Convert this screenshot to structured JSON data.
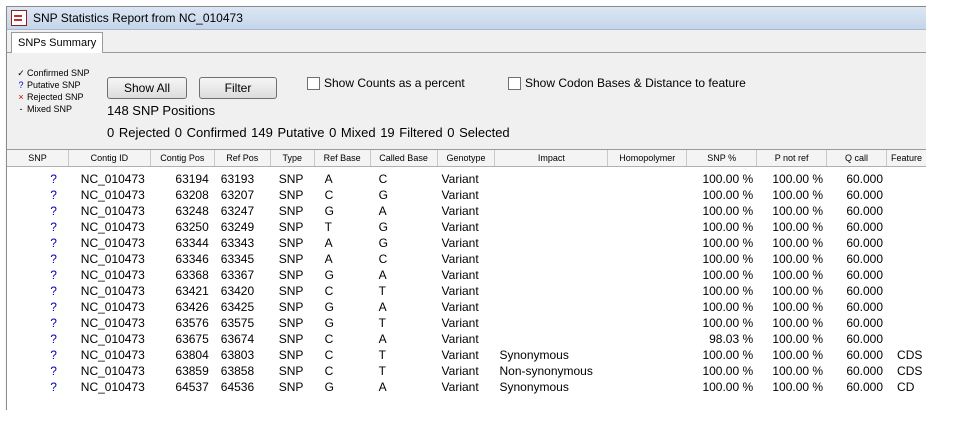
{
  "window": {
    "title": "SNP Statistics Report from NC_010473"
  },
  "tabs": [
    {
      "label": "SNPs Summary"
    }
  ],
  "legend": {
    "items": [
      {
        "symbol": "✓",
        "label": "Confirmed SNP"
      },
      {
        "symbol": "?",
        "label": "Putative SNP"
      },
      {
        "symbol": "×",
        "label": "Rejected SNP"
      },
      {
        "symbol": "-",
        "label": "Mixed SNP"
      }
    ]
  },
  "buttons": {
    "show_all": "Show All",
    "filter": "Filter"
  },
  "checkboxes": {
    "counts_percent": "Show Counts as a percent",
    "codon_bases": "Show Codon Bases & Distance to feature"
  },
  "summary": {
    "positions": "148 SNP Positions",
    "counts": "0 Rejected  0 Confirmed  149 Putative  0 Mixed  19 Filtered  0 Selected"
  },
  "table": {
    "columns": [
      "SNP",
      "Contig ID",
      "Contig Pos",
      "Ref Pos",
      "Type",
      "Ref Base",
      "Called Base",
      "Genotype",
      "Impact",
      "Homopolymer",
      "SNP %",
      "P not ref",
      "Q call",
      "Feature"
    ],
    "rows": [
      [
        "?",
        "NC_010473",
        "63194",
        "63193",
        "SNP",
        "A",
        "C",
        "Variant",
        "",
        "",
        "100.00 %",
        "100.00 %",
        "60.000",
        ""
      ],
      [
        "?",
        "NC_010473",
        "63208",
        "63207",
        "SNP",
        "C",
        "G",
        "Variant",
        "",
        "",
        "100.00 %",
        "100.00 %",
        "60.000",
        ""
      ],
      [
        "?",
        "NC_010473",
        "63248",
        "63247",
        "SNP",
        "G",
        "A",
        "Variant",
        "",
        "",
        "100.00 %",
        "100.00 %",
        "60.000",
        ""
      ],
      [
        "?",
        "NC_010473",
        "63250",
        "63249",
        "SNP",
        "T",
        "G",
        "Variant",
        "",
        "",
        "100.00 %",
        "100.00 %",
        "60.000",
        ""
      ],
      [
        "?",
        "NC_010473",
        "63344",
        "63343",
        "SNP",
        "A",
        "G",
        "Variant",
        "",
        "",
        "100.00 %",
        "100.00 %",
        "60.000",
        ""
      ],
      [
        "?",
        "NC_010473",
        "63346",
        "63345",
        "SNP",
        "A",
        "C",
        "Variant",
        "",
        "",
        "100.00 %",
        "100.00 %",
        "60.000",
        ""
      ],
      [
        "?",
        "NC_010473",
        "63368",
        "63367",
        "SNP",
        "G",
        "A",
        "Variant",
        "",
        "",
        "100.00 %",
        "100.00 %",
        "60.000",
        ""
      ],
      [
        "?",
        "NC_010473",
        "63421",
        "63420",
        "SNP",
        "C",
        "T",
        "Variant",
        "",
        "",
        "100.00 %",
        "100.00 %",
        "60.000",
        ""
      ],
      [
        "?",
        "NC_010473",
        "63426",
        "63425",
        "SNP",
        "G",
        "A",
        "Variant",
        "",
        "",
        "100.00 %",
        "100.00 %",
        "60.000",
        ""
      ],
      [
        "?",
        "NC_010473",
        "63576",
        "63575",
        "SNP",
        "G",
        "T",
        "Variant",
        "",
        "",
        "100.00 %",
        "100.00 %",
        "60.000",
        ""
      ],
      [
        "?",
        "NC_010473",
        "63675",
        "63674",
        "SNP",
        "C",
        "A",
        "Variant",
        "",
        "",
        "98.03 %",
        "100.00 %",
        "60.000",
        ""
      ],
      [
        "?",
        "NC_010473",
        "63804",
        "63803",
        "SNP",
        "C",
        "T",
        "Variant",
        "Synonymous",
        "",
        "100.00 %",
        "100.00 %",
        "60.000",
        "CDS"
      ],
      [
        "?",
        "NC_010473",
        "63859",
        "63858",
        "SNP",
        "C",
        "T",
        "Variant",
        "Non-synonymous",
        "",
        "100.00 %",
        "100.00 %",
        "60.000",
        "CDS"
      ],
      [
        "?",
        "NC_010473",
        "64537",
        "64536",
        "SNP",
        "G",
        "A",
        "Variant",
        "Synonymous",
        "",
        "100.00 %",
        "100.00 %",
        "60.000",
        "CD"
      ]
    ]
  }
}
